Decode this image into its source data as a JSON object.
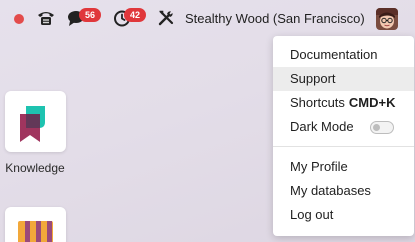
{
  "topbar": {
    "status_color": "#e34b4b",
    "icons": [
      "phone-icon",
      "chat-icon",
      "clock-icon",
      "tools-icon"
    ],
    "chat_badge": "56",
    "activity_badge": "42",
    "company_name": "Stealthy Wood (San Francisco)"
  },
  "apps": [
    {
      "label": "Knowledge",
      "icon": "knowledge-app-icon"
    },
    {
      "label": "",
      "icon": "app-icon"
    }
  ],
  "user_menu": {
    "items": [
      {
        "label": "Documentation"
      },
      {
        "label": "Support",
        "highlighted": true
      },
      {
        "label": "Shortcuts",
        "key": "CMD+K"
      },
      {
        "label": "Dark Mode",
        "toggle": false
      },
      {
        "label": "My Profile"
      },
      {
        "label": "My databases"
      },
      {
        "label": "Log out"
      }
    ]
  },
  "colors": {
    "badge": "#e0373b",
    "knowledge_teal": "#1ec3b0",
    "knowledge_plum": "#a0355e"
  }
}
